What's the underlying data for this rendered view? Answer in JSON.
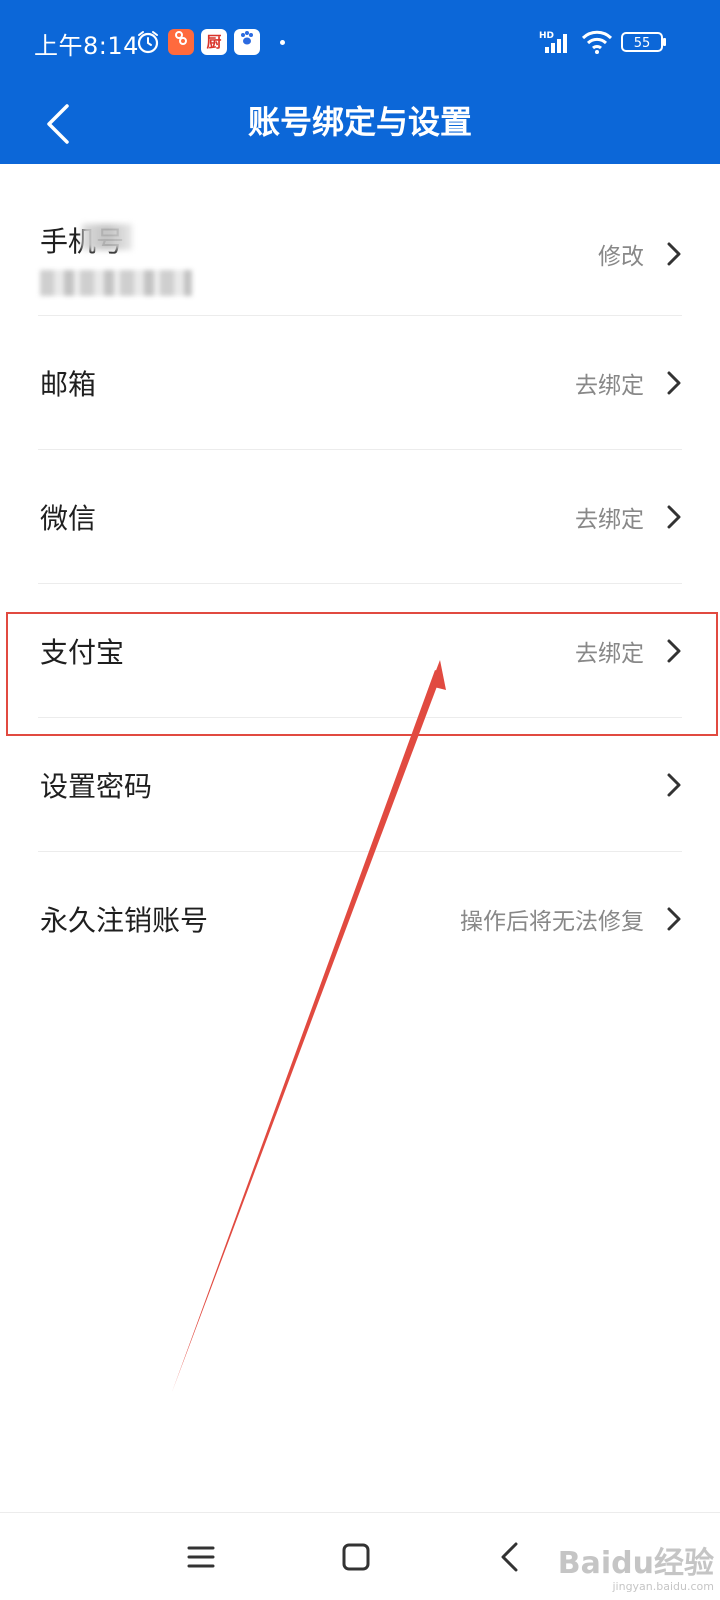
{
  "status_bar": {
    "time": "上午8:14",
    "notif_icons": [
      "app-orange-icon",
      "kitchen-app-icon",
      "paw-app-icon"
    ],
    "notif_kitchen_glyph": "厨",
    "network": "HD",
    "battery": "55"
  },
  "header": {
    "title": "账号绑定与设置",
    "back_icon": "back-chevron-icon"
  },
  "settings": {
    "phone": {
      "label": "手机号",
      "action": "修改"
    },
    "email": {
      "label": "邮箱",
      "action": "去绑定"
    },
    "wechat": {
      "label": "微信",
      "action": "去绑定"
    },
    "alipay": {
      "label": "支付宝",
      "action": "去绑定"
    },
    "password": {
      "label": "设置密码",
      "action": ""
    },
    "delete_account": {
      "label": "永久注销账号",
      "action": "操作后将无法修复"
    }
  },
  "watermark": {
    "logo": "Baidu经验",
    "url": "jingyan.baidu.com"
  },
  "colors": {
    "header_bg": "#0c67d8",
    "annotation": "#e14a40"
  }
}
